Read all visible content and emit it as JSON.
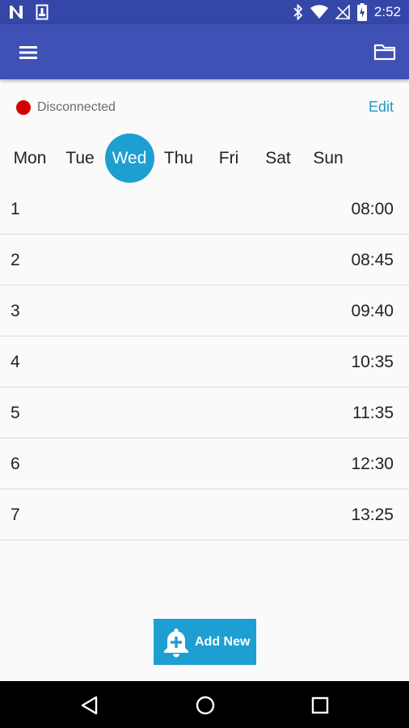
{
  "status_bar": {
    "time": "2:52",
    "icons": [
      "n-logo-icon",
      "sim-card-icon",
      "bluetooth-icon",
      "wifi-icon",
      "no-signal-icon",
      "battery-icon"
    ]
  },
  "app_bar": {
    "menu_icon": "hamburger-menu-icon",
    "folder_icon": "folder-icon"
  },
  "connection": {
    "status_label": "Disconnected",
    "status_color": "#d50000",
    "edit_label": "Edit"
  },
  "days": [
    {
      "label": "Mon",
      "active": false
    },
    {
      "label": "Tue",
      "active": false
    },
    {
      "label": "Wed",
      "active": true
    },
    {
      "label": "Thu",
      "active": false
    },
    {
      "label": "Fri",
      "active": false
    },
    {
      "label": "Sat",
      "active": false
    },
    {
      "label": "Sun",
      "active": false
    }
  ],
  "schedule": [
    {
      "number": "1",
      "time": "08:00"
    },
    {
      "number": "2",
      "time": "08:45"
    },
    {
      "number": "3",
      "time": "09:40"
    },
    {
      "number": "4",
      "time": "10:35"
    },
    {
      "number": "5",
      "time": "11:35"
    },
    {
      "number": "6",
      "time": "12:30"
    },
    {
      "number": "7",
      "time": "13:25"
    }
  ],
  "add_button": {
    "label": "Add New",
    "icon": "bell-plus-icon"
  },
  "nav_bar": {
    "icons": [
      "back-icon",
      "home-icon",
      "recents-icon"
    ]
  },
  "colors": {
    "primary": "#3f51b5",
    "status_bar": "#3446a8",
    "accent": "#1e9fd2"
  }
}
